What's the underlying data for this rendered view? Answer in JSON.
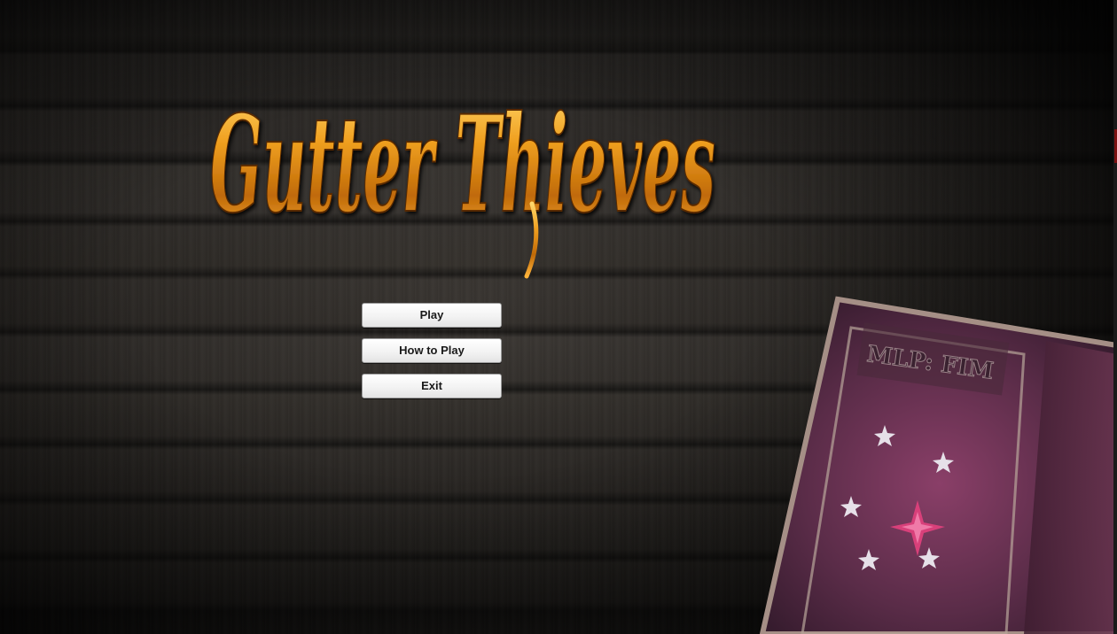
{
  "game": {
    "title": "Gutter Thieves"
  },
  "menu": {
    "buttons": [
      {
        "label": "Play"
      },
      {
        "label": "How to Play"
      },
      {
        "label": "Exit"
      }
    ]
  },
  "book": {
    "cover_text": "MLP: FIM"
  },
  "colors": {
    "logo_gold": "#f0a020",
    "logo_dark": "#6b3600",
    "book_purple": "#6a3550",
    "book_magenta": "#d8407a",
    "button_face": "#f3f3f3"
  }
}
